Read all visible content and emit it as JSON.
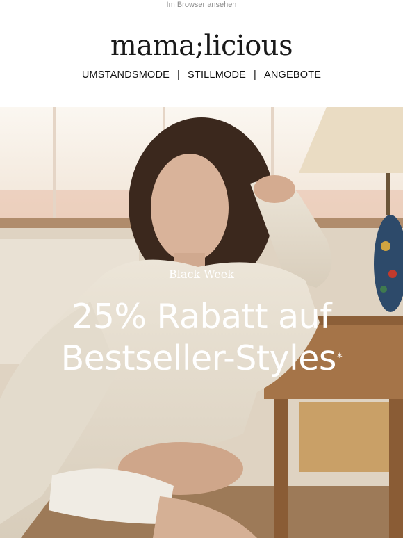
{
  "header": {
    "browser_link": "Im Browser ansehen",
    "logo_text": "mama;licious"
  },
  "nav": {
    "items": [
      "UMSTANDSMODE",
      "STILLMODE",
      "ANGEBOTE"
    ],
    "separator": "|"
  },
  "hero": {
    "eyebrow": "Black Week",
    "headline_line1": "25% Rabatt auf",
    "headline_line2": "Bestseller-Styles",
    "asterisk": "*",
    "text_color": "#ffffff"
  }
}
